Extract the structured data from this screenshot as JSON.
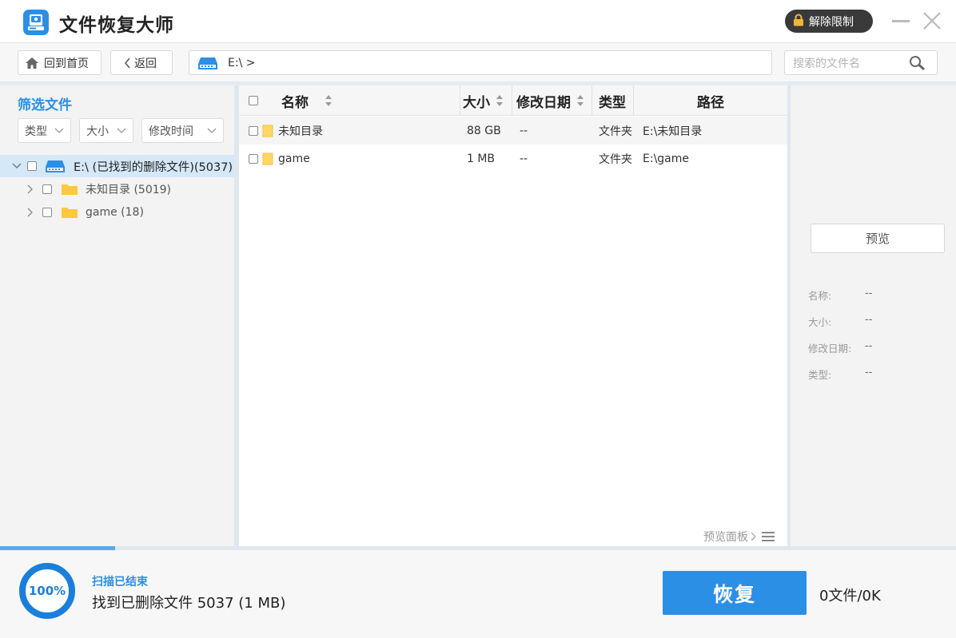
{
  "app": {
    "title": "文件恢复大师",
    "unlock_label": "解除限制"
  },
  "toolbar": {
    "home_label": "回到首页",
    "back_label": "返回",
    "path_text": "E:\\ >",
    "search_placeholder": "搜索的文件名"
  },
  "filter": {
    "title": "筛选文件",
    "type_label": "类型",
    "size_label": "大小",
    "time_label": "修改时间"
  },
  "tree": {
    "root_label": "E:\\ (已找到的删除文件)(5037)",
    "children": [
      {
        "label": "未知目录 (5019)"
      },
      {
        "label": "game (18)"
      }
    ]
  },
  "table": {
    "columns": {
      "name": "名称",
      "size": "大小",
      "date": "修改日期",
      "type": "类型",
      "path": "路径"
    },
    "rows": [
      {
        "name": "未知目录",
        "size": "88 GB",
        "date": "--",
        "type": "文件夹",
        "path": "E:\\未知目录"
      },
      {
        "name": "game",
        "size": "1 MB",
        "date": "--",
        "type": "文件夹",
        "path": "E:\\game"
      }
    ],
    "preview_panel_label": "预览面板"
  },
  "preview": {
    "button_label": "预览",
    "info": [
      {
        "label": "名称:",
        "value": "--"
      },
      {
        "label": "大小:",
        "value": "--"
      },
      {
        "label": "修改日期:",
        "value": "--"
      },
      {
        "label": "类型:",
        "value": "--"
      }
    ]
  },
  "status": {
    "progress_label": "100%",
    "progress_value": 1.0,
    "scan_progress_fraction": 0.12,
    "scan_status": "扫描已结束",
    "summary": "找到已删除文件 5037 (1 MB)",
    "recover_label": "恢复",
    "selected_count": "0文件/0K"
  },
  "colors": {
    "accent": "#2b8fe6",
    "folder": "#ffc83d"
  }
}
